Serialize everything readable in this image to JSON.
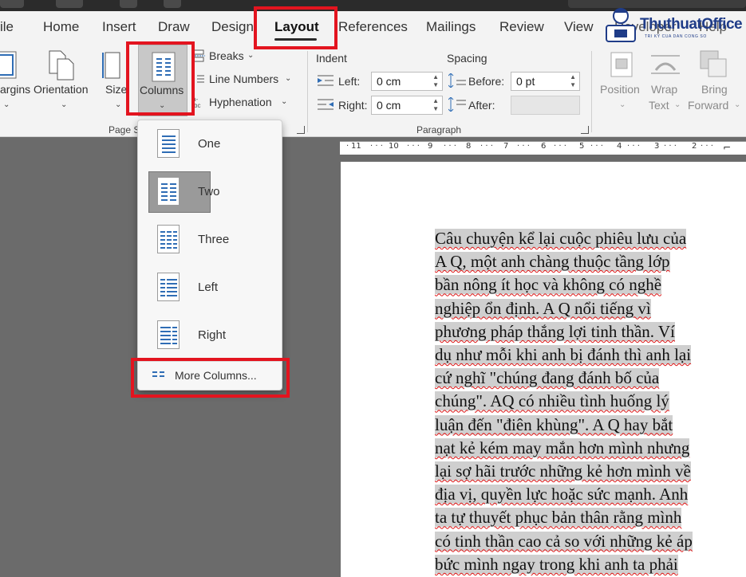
{
  "tabs": {
    "file": "ile",
    "home": "Home",
    "insert": "Insert",
    "draw": "Draw",
    "design": "Design",
    "layout": "Layout",
    "references": "References",
    "mailings": "Mailings",
    "review": "Review",
    "view": "View",
    "developer": "Developer",
    "help": "Help"
  },
  "ribbon": {
    "page_setup": {
      "margins": "argins",
      "orientation": "Orientation",
      "size": "Size",
      "columns": "Columns",
      "breaks": "Breaks",
      "line_numbers": "Line Numbers",
      "hyphenation": "Hyphenation",
      "group_label": "Page S"
    },
    "paragraph": {
      "indent_heading": "Indent",
      "spacing_heading": "Spacing",
      "left_label": "Left:",
      "right_label": "Right:",
      "before_label": "Before:",
      "after_label": "After:",
      "left_value": "0 cm",
      "right_value": "0 cm",
      "before_value": "0 pt",
      "after_value": "",
      "group_label": "Paragraph"
    },
    "arrange": {
      "position": "Position",
      "wrap_text_1": "Wrap",
      "wrap_text_2": "Text",
      "bring_forward_1": "Bring",
      "bring_forward_2": "Forward"
    }
  },
  "columns_menu": {
    "options": [
      {
        "label": "One"
      },
      {
        "label": "Two"
      },
      {
        "label": "Three"
      },
      {
        "label": "Left"
      },
      {
        "label": "Right"
      }
    ],
    "selected": "Two",
    "more": "More Columns..."
  },
  "ruler": {
    "ticks": [
      "11",
      "10",
      "9",
      "8",
      "7",
      "6",
      "5",
      "4",
      "3",
      "2"
    ]
  },
  "document": {
    "lines": [
      "Câu chuyện kể lại cuộc phiêu lưu của",
      "A Q, một anh chàng thuộc tầng lớp",
      "bần nông ít học và không có nghề",
      "nghiệp ổn định. A Q nổi tiếng vì",
      "phương pháp thắng lợi tinh thần. Ví",
      "dụ như mỗi khi anh bị đánh thì anh lại",
      "cứ nghĩ \"chúng đang đánh bố của",
      "chúng\". AQ có nhiều tình huống lý",
      "luận đến \"điên khùng\". A Q hay bắt",
      "nạt kẻ kém may mắn hơn mình nhưng",
      "lại sợ hãi trước những kẻ hơn mình về",
      "địa vị, quyền lực hoặc sức mạnh. Anh",
      "ta tự thuyết phục bản thân rằng mình",
      "có tinh thần cao cả so với những kẻ áp",
      "bức mình ngay trong khi anh ta phải"
    ]
  },
  "watermark": {
    "brand": "ThuthuatOffice",
    "tagline": "TRI KY CUA DAN CONG SO"
  },
  "colors": {
    "highlight_box": "#e3141f",
    "column_icon_blue": "#2f6db5",
    "ribbon_bg": "#f3f3f3",
    "workspace_bg": "#6b6b6b"
  }
}
